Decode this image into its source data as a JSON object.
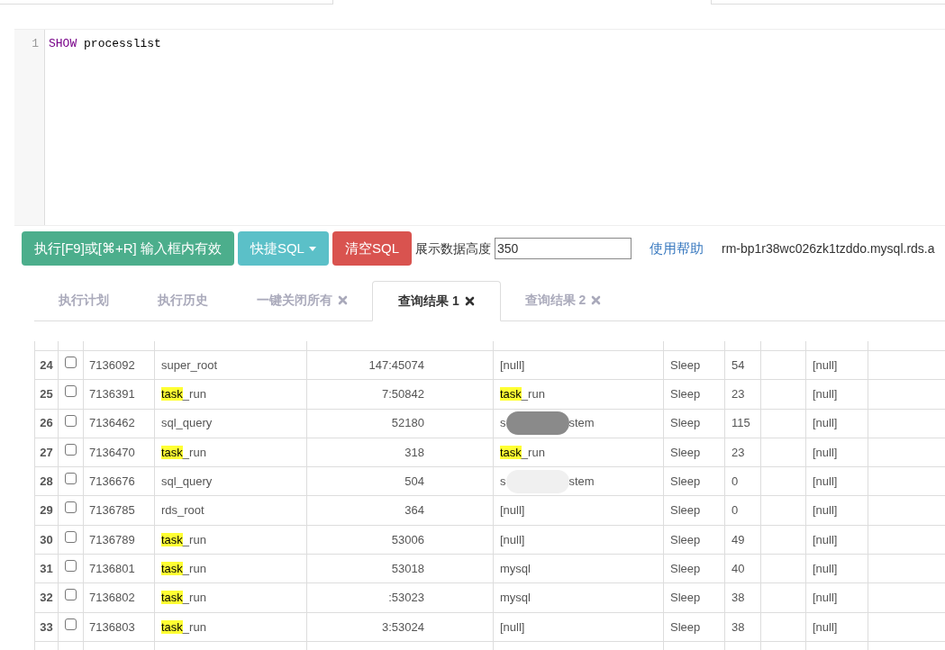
{
  "editor": {
    "lines": [
      {
        "number": "1",
        "keyword": "SHOW",
        "rest": "processlist"
      }
    ]
  },
  "toolbar": {
    "run_button": "执行[F9]或[⌘+R] 输入框内有效",
    "quick_sql_button": "快捷SQL",
    "clear_button": "清空SQL",
    "height_label": "展示数据高度",
    "height_value": "350",
    "help_link": "使用帮助",
    "instance": "rm-bp1r38wc026zk1tzddo.mysql.rds.a"
  },
  "tabs": [
    {
      "label": "执行计划",
      "closable": false,
      "selected": false
    },
    {
      "label": "执行历史",
      "closable": false,
      "selected": false
    },
    {
      "label": "一键关闭所有",
      "closable": true,
      "selected": false
    },
    {
      "label": "查询结果 1",
      "closable": true,
      "selected": true
    },
    {
      "label": "查询结果 2",
      "closable": true,
      "selected": false
    }
  ],
  "table": {
    "rows": [
      {
        "index": "24",
        "checked": false,
        "id": "7136092",
        "user": [
          {
            "text": "super_root",
            "highlighted": false
          }
        ],
        "host": "147:45074",
        "db": [
          {
            "text": "[null]",
            "highlighted": false
          }
        ],
        "command": "Sleep",
        "time": "54",
        "info": "[null]"
      },
      {
        "index": "25",
        "checked": false,
        "id": "7136391",
        "user": [
          {
            "text": "task",
            "highlighted": true
          },
          {
            "text": "_run",
            "highlighted": false
          }
        ],
        "host": "7:50842",
        "db": [
          {
            "text": "task",
            "highlighted": true
          },
          {
            "text": "_run",
            "highlighted": false
          }
        ],
        "command": "Sleep",
        "time": "23",
        "info": "[null]"
      },
      {
        "index": "26",
        "checked": false,
        "id": "7136462",
        "user": [
          {
            "text": "sql_query",
            "highlighted": false
          }
        ],
        "host": "52180",
        "db": [
          {
            "kind": "text",
            "text": "s",
            "highlighted": false
          },
          {
            "kind": "redaction",
            "color": "#8a8a8a"
          },
          {
            "kind": "text",
            "text": "stem",
            "highlighted": false
          }
        ],
        "command": "Sleep",
        "time": "115",
        "info": "[null]"
      },
      {
        "index": "27",
        "checked": false,
        "id": "7136470",
        "user": [
          {
            "text": "task",
            "highlighted": true
          },
          {
            "text": "_run",
            "highlighted": false
          }
        ],
        "host": "318",
        "db": [
          {
            "text": "task",
            "highlighted": true
          },
          {
            "text": "_run",
            "highlighted": false
          }
        ],
        "command": "Sleep",
        "time": "23",
        "info": "[null]"
      },
      {
        "index": "28",
        "checked": false,
        "id": "7136676",
        "user": [
          {
            "text": "sql_query",
            "highlighted": false
          }
        ],
        "host": "504",
        "db": [
          {
            "kind": "text",
            "text": "s",
            "highlighted": false
          },
          {
            "kind": "redaction",
            "color": "#f0f0f0"
          },
          {
            "kind": "text",
            "text": "stem",
            "highlighted": false
          }
        ],
        "command": "Sleep",
        "time": "0",
        "info": "[null]"
      },
      {
        "index": "29",
        "checked": false,
        "id": "7136785",
        "user": [
          {
            "text": "rds_root",
            "highlighted": false
          }
        ],
        "host": "364",
        "db": [
          {
            "text": "[null]",
            "highlighted": false
          }
        ],
        "command": "Sleep",
        "time": "0",
        "info": "[null]"
      },
      {
        "index": "30",
        "checked": false,
        "id": "7136789",
        "user": [
          {
            "text": "task",
            "highlighted": true
          },
          {
            "text": "_run",
            "highlighted": false
          }
        ],
        "host": "53006",
        "db": [
          {
            "text": "[null]",
            "highlighted": false
          }
        ],
        "command": "Sleep",
        "time": "49",
        "info": "[null]"
      },
      {
        "index": "31",
        "checked": false,
        "id": "7136801",
        "user": [
          {
            "text": "task",
            "highlighted": true
          },
          {
            "text": "_run",
            "highlighted": false
          }
        ],
        "host": "53018",
        "db": [
          {
            "text": "mysql",
            "highlighted": false
          }
        ],
        "command": "Sleep",
        "time": "40",
        "info": "[null]"
      },
      {
        "index": "32",
        "checked": false,
        "id": "7136802",
        "user": [
          {
            "text": "task",
            "highlighted": true
          },
          {
            "text": "_run",
            "highlighted": false
          }
        ],
        "host": ":53023",
        "db": [
          {
            "text": "mysql",
            "highlighted": false
          }
        ],
        "command": "Sleep",
        "time": "38",
        "info": "[null]"
      },
      {
        "index": "33",
        "checked": false,
        "id": "7136803",
        "user": [
          {
            "text": "task",
            "highlighted": true
          },
          {
            "text": "_run",
            "highlighted": false
          }
        ],
        "host": "3:53024",
        "db": [
          {
            "text": "[null]",
            "highlighted": false
          }
        ],
        "command": "Sleep",
        "time": "38",
        "info": "[null]"
      }
    ]
  }
}
